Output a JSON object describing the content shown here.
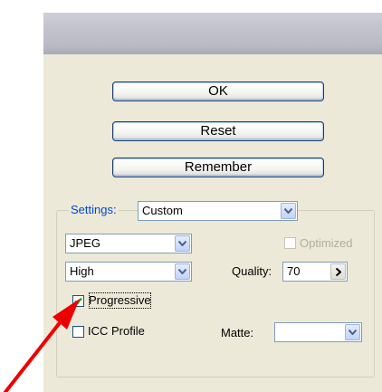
{
  "buttons": {
    "ok": "OK",
    "reset": "Reset",
    "remember": "Remember"
  },
  "settings": {
    "legend": "Settings:",
    "preset": "Custom",
    "format": "JPEG",
    "quality_preset": "High",
    "optimized_label": "Optimized",
    "optimized_checked": false,
    "quality_label": "Quality:",
    "quality_value": "70",
    "progressive_label": "Progressive",
    "progressive_checked": true,
    "icc_label": "ICC Profile",
    "icc_checked": false,
    "matte_label": "Matte:",
    "matte_value": ""
  },
  "annotation": {
    "arrow_color": "#ee0000"
  },
  "colors": {
    "accent": "#0046d5",
    "panel": "#ece9d8",
    "check": "#21a121"
  }
}
